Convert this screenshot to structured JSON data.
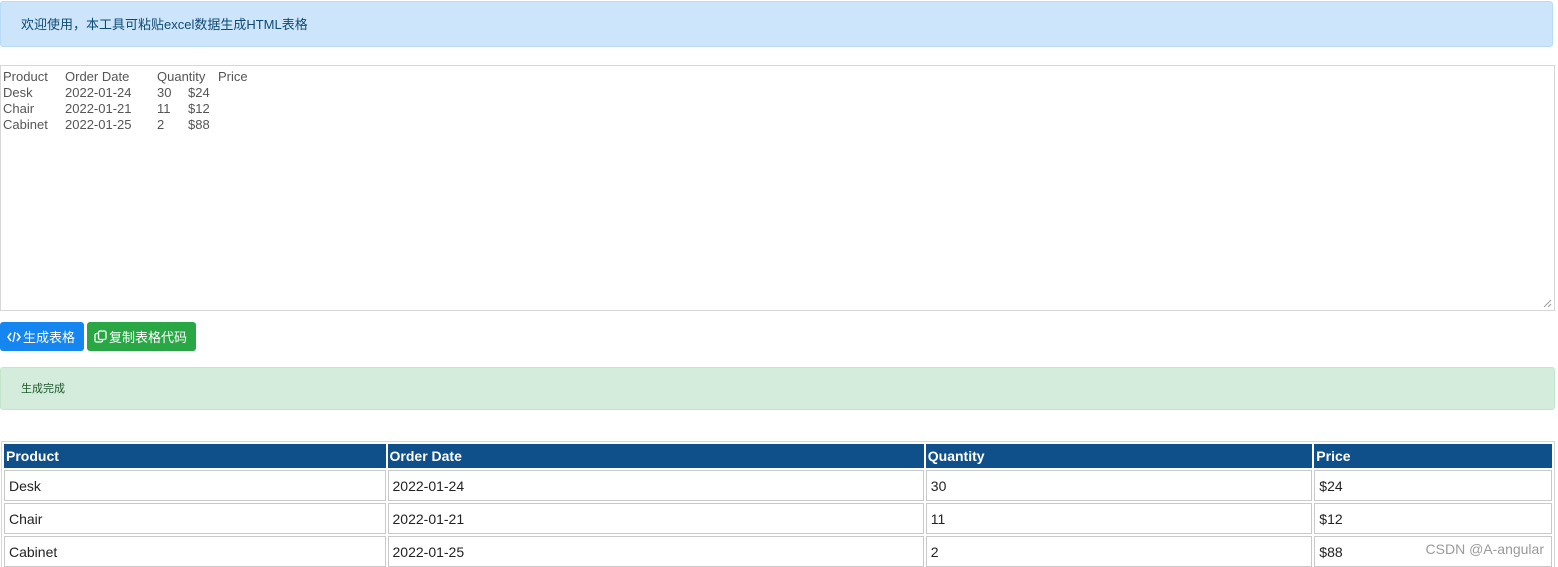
{
  "header": {
    "welcome_text": "欢迎使用，本工具可粘贴excel数据生成HTML表格"
  },
  "input": {
    "rows": [
      [
        "Product",
        "Order Date",
        "Quantity",
        "Price"
      ],
      [
        "Desk",
        "2022-01-24",
        "30",
        "$24"
      ],
      [
        "Chair",
        "2022-01-21",
        "11",
        "$12"
      ],
      [
        "Cabinet",
        "2022-01-25",
        "2",
        "$88"
      ]
    ]
  },
  "toolbar": {
    "generate_label": "生成表格",
    "copy_label": "复制表格代码",
    "generate_icon": "code-icon",
    "copy_icon": "copy-icon"
  },
  "status": {
    "message": "生成完成"
  },
  "table": {
    "headers": [
      "Product",
      "Order Date",
      "Quantity",
      "Price"
    ],
    "rows": [
      [
        "Desk",
        "2022-01-24",
        "30",
        "$24"
      ],
      [
        "Chair",
        "2022-01-21",
        "11",
        "$12"
      ],
      [
        "Cabinet",
        "2022-01-25",
        "2",
        "$88"
      ]
    ]
  },
  "watermark": "CSDN @A-angular",
  "colors": {
    "info_bg": "#cce5fb",
    "primary": "#1585f0",
    "success": "#2aa745",
    "success_bg": "#d4ecdc",
    "table_header": "#0f4f8a"
  }
}
